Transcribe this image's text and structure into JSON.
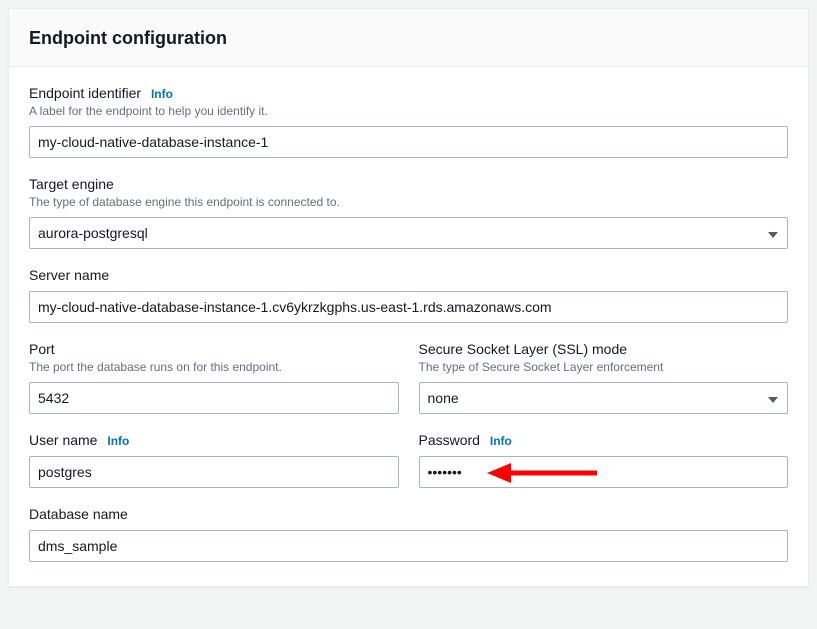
{
  "panel": {
    "title": "Endpoint configuration"
  },
  "fields": {
    "endpoint_identifier": {
      "label": "Endpoint identifier",
      "info": "Info",
      "help": "A label for the endpoint to help you identify it.",
      "value": "my-cloud-native-database-instance-1"
    },
    "target_engine": {
      "label": "Target engine",
      "help": "The type of database engine this endpoint is connected to.",
      "value": "aurora-postgresql"
    },
    "server_name": {
      "label": "Server name",
      "value": "my-cloud-native-database-instance-1.cv6ykrzkgphs.us-east-1.rds.amazonaws.com"
    },
    "port": {
      "label": "Port",
      "help": "The port the database runs on for this endpoint.",
      "value": "5432"
    },
    "ssl_mode": {
      "label": "Secure Socket Layer (SSL) mode",
      "help": "The type of Secure Socket Layer enforcement",
      "value": "none"
    },
    "user_name": {
      "label": "User name",
      "info": "Info",
      "value": "postgres"
    },
    "password": {
      "label": "Password",
      "info": "Info",
      "value": "•••••••"
    },
    "database_name": {
      "label": "Database name",
      "value": "dms_sample"
    }
  }
}
